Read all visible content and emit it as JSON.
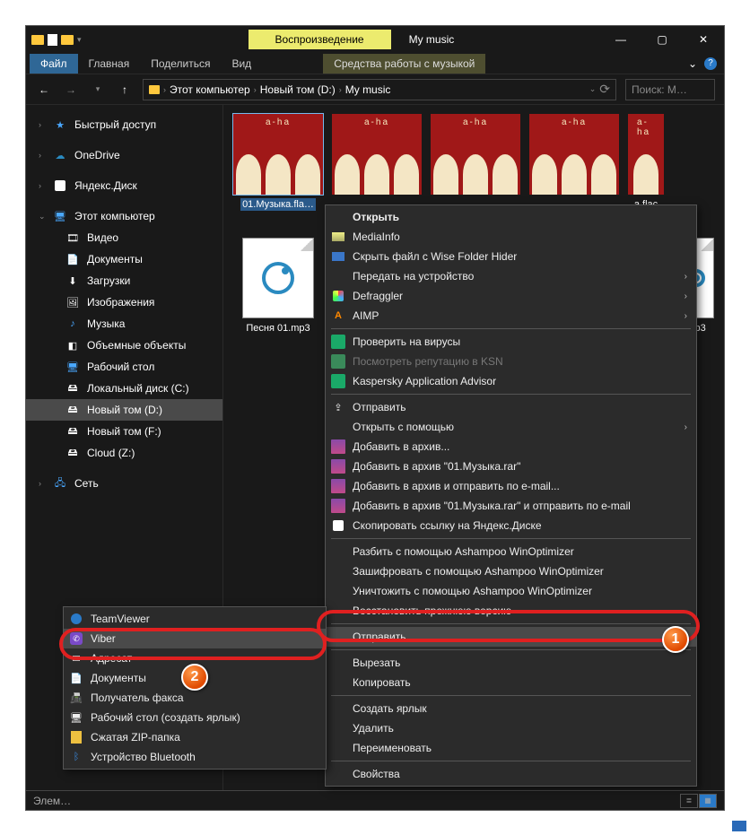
{
  "title": "My music",
  "ribbon_contextual": "Воспроизведение",
  "tabs": {
    "file": "Файл",
    "home": "Главная",
    "share": "Поделиться",
    "view": "Вид",
    "music": "Средства работы с музыкой"
  },
  "breadcrumb": [
    "Этот компьютер",
    "Новый том (D:)",
    "My music"
  ],
  "search_placeholder": "Поиск: M…",
  "sidebar": {
    "quick_access": "Быстрый доступ",
    "onedrive": "OneDrive",
    "yandex_disk": "Яндекс.Диск",
    "this_pc": "Этот компьютер",
    "videos": "Видео",
    "documents": "Документы",
    "downloads": "Загрузки",
    "pictures": "Изображения",
    "music": "Музыка",
    "objects3d": "Объемные объекты",
    "desktop": "Рабочий стол",
    "drive_c": "Локальный диск (C:)",
    "drive_d": "Новый том (D:)",
    "drive_f": "Новый том (F:)",
    "drive_z": "Cloud (Z:)",
    "network": "Сеть"
  },
  "files": {
    "f1": "01.Музыка.fla…",
    "f5_tail": "a.flac",
    "mp3a": "Песня 01.mp3",
    "mp3b_tail": "mp3"
  },
  "ctx": {
    "open": "Открыть",
    "mediainfo": "MediaInfo",
    "wise_hide": "Скрыть файл с Wise Folder Hider",
    "cast": "Передать на устройство",
    "defraggler": "Defraggler",
    "aimp": "AIMP",
    "virus_check": "Проверить на вирусы",
    "ksn": "Посмотреть репутацию в KSN",
    "kav_advisor": "Kaspersky Application Advisor",
    "send1": "Отправить",
    "open_with": "Открыть с помощью",
    "add_archive": "Добавить в архив...",
    "add_archive_name": "Добавить в архив \"01.Музыка.rar\"",
    "add_email": "Добавить в архив и отправить по e-mail...",
    "add_email_name": "Добавить в архив \"01.Музыка.rar\" и отправить по e-mail",
    "yadisk_copy": "Скопировать ссылку на Яндекс.Диске",
    "ashampoo_split": "Разбить с помощью Ashampoo WinOptimizer",
    "ashampoo_encrypt": "Зашифровать с помощью Ashampoo WinOptimizer",
    "ashampoo_destroy": "Уничтожить с помощью Ashampoo WinOptimizer",
    "restore_prev": "Восстановить прежнюю версию",
    "send_to": "Отправить",
    "cut": "Вырезать",
    "copy": "Копировать",
    "shortcut": "Создать ярлык",
    "delete": "Удалить",
    "rename": "Переименовать",
    "properties": "Свойства"
  },
  "sub": {
    "teamviewer_tail": "TeamViewer",
    "viber": "Viber",
    "addr_tail": "Адресат",
    "documents": "Документы",
    "fax": "Получатель факса",
    "desktop_link": "Рабочий стол (создать ярлык)",
    "zip": "Сжатая ZIP-папка",
    "bluetooth": "Устройство Bluetooth"
  },
  "status": "Элем…",
  "badges": {
    "b1": "1",
    "b2": "2"
  }
}
